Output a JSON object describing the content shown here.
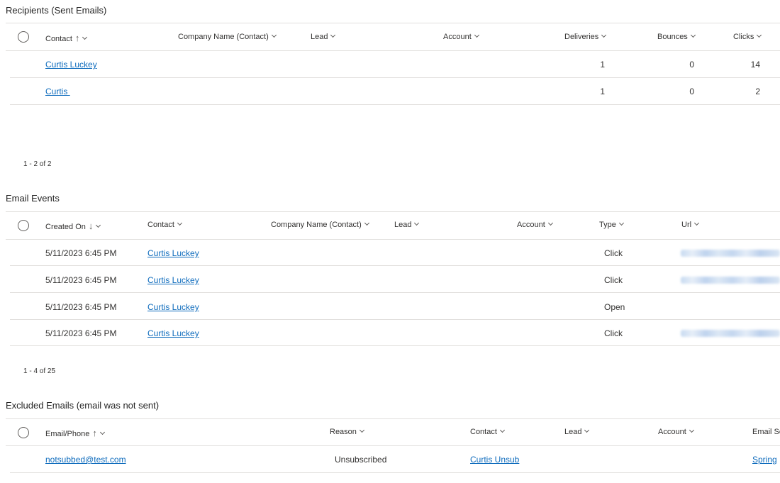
{
  "recipients": {
    "title": "Recipients (Sent Emails)",
    "columns": [
      "Contact",
      "Company Name (Contact)",
      "Lead",
      "Account",
      "Deliveries",
      "Bounces",
      "Clicks"
    ],
    "rows": [
      {
        "contact": "Curtis Luckey",
        "deliveries": "1",
        "bounces": "0",
        "clicks": "14"
      },
      {
        "contact": "Curtis ",
        "deliveries": "1",
        "bounces": "0",
        "clicks": "2"
      }
    ],
    "pager": "1 - 2 of 2"
  },
  "email_events": {
    "title": "Email Events",
    "columns": [
      "Created On",
      "Contact",
      "Company Name (Contact)",
      "Lead",
      "Account",
      "Type",
      "Url"
    ],
    "rows": [
      {
        "created_on": "5/11/2023 6:45 PM",
        "contact": "Curtis Luckey",
        "type": "Click"
      },
      {
        "created_on": "5/11/2023 6:45 PM",
        "contact": "Curtis Luckey",
        "type": "Click"
      },
      {
        "created_on": "5/11/2023 6:45 PM",
        "contact": "Curtis Luckey",
        "type": "Open"
      },
      {
        "created_on": "5/11/2023 6:45 PM",
        "contact": "Curtis Luckey",
        "type": "Click"
      }
    ],
    "pager": "1 - 4 of 25"
  },
  "excluded": {
    "title": "Excluded Emails (email was not sent)",
    "columns": [
      "Email/Phone",
      "Reason",
      "Contact",
      "Lead",
      "Account",
      "Email Se"
    ],
    "rows": [
      {
        "email": "notsubbed@test.com",
        "reason": "Unsubscribed",
        "contact": "Curtis Unsub",
        "email_send": "Spring"
      }
    ]
  },
  "icons": {
    "select_all": "select-all-circle-icon",
    "sort_ascending": "sort-ascending-arrow-icon",
    "sort_descending": "sort-descending-arrow-icon",
    "column_menu": "chevron-down-icon"
  },
  "colors": {
    "link": "#0f6cbd",
    "divider": "#e1dfdd",
    "text": "#323130"
  }
}
